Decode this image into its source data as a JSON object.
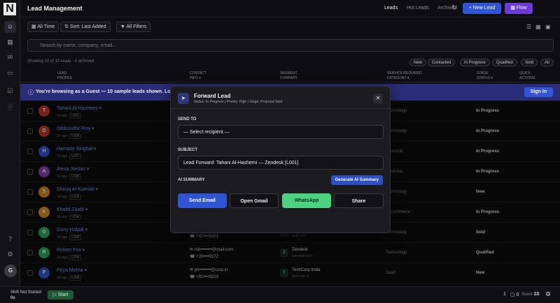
{
  "app": {
    "logo": "N",
    "title": "Lead Management",
    "tabs": [
      "Leads",
      "Hot Leads",
      "Archived"
    ],
    "new_lead": "+ New Lead",
    "flow": "Flow"
  },
  "sidebar": {
    "user_initial": "G"
  },
  "filters": {
    "all_time": "All Time",
    "sort": "Sort: Last Added",
    "all_filters": "All Filters"
  },
  "search": {
    "placeholder": "Search by name, company, email..."
  },
  "showing": "Showing 10 of 10 leads · 0 archived",
  "stat_chips": [
    "New",
    "Contacted",
    "In Progress",
    "Qualified",
    "Sold",
    "All"
  ],
  "columns": {
    "lead": [
      "LEAD",
      "PROFILE"
    ],
    "contact": [
      "CONTACT",
      "INFO ▾"
    ],
    "segment": [
      "SEGMENT",
      "COMPANY"
    ],
    "service": [
      "SERVICE REQUIRED",
      "CATEGORY ▾"
    ],
    "stage": [
      "STAGE",
      "STATUS ▾"
    ],
    "quick": [
      "QUICK",
      "ACTIONS"
    ]
  },
  "banner": {
    "text": "You're browsing as a Guest — 10 sample leads shown. Log in t",
    "signin": "Sign In"
  },
  "leads": [
    {
      "initial": "T",
      "color": "#c0392b",
      "name": "Tahani Al-Hashemi",
      "ago": "1d ago",
      "tag": "L001",
      "email": "",
      "phone": "",
      "company": "",
      "site": "",
      "category": "Technology",
      "status": "In Progress"
    },
    {
      "initial": "D",
      "color": "#c0392b",
      "name": "Dibbondho Roy",
      "ago": "2h ago",
      "tag": "L002",
      "email": "",
      "phone": "",
      "company": "",
      "site": "",
      "category": "Technology",
      "status": "In Progress"
    },
    {
      "initial": "H",
      "color": "#2f55d4",
      "name": "Hamasy Singhal",
      "ago": "2h ago",
      "tag": "L007",
      "email": "",
      "phone": "",
      "company": "",
      "site": "",
      "category": "Financial",
      "status": "In Progress"
    },
    {
      "initial": "A",
      "color": "#8e44ad",
      "name": "Alexa Jordan",
      "ago": "1d ago",
      "tag": "L005",
      "email": "",
      "phone": "",
      "company": "",
      "site": "",
      "category": "Financial",
      "status": "In Progress"
    },
    {
      "initial": "S",
      "color": "#d98b1f",
      "name": "Shouq Al-Kumaiti",
      "ago": "1d ago",
      "tag": "L003",
      "email": "",
      "phone": "",
      "company": "",
      "site": "",
      "category": "Technology",
      "status": "New"
    },
    {
      "initial": "K",
      "color": "#d98b1f",
      "name": "Khalid Zaabi",
      "ago": "2d ago",
      "tag": "L004",
      "email": "",
      "phone": "",
      "company": "",
      "site": "",
      "category": "E-Commerce",
      "status": "In Progress"
    },
    {
      "initial": "G",
      "color": "#27ae60",
      "name": "Gany Halpal",
      "ago": "2d ago",
      "tag": "L009",
      "email": "gan••••@mail.com",
      "phone": "+97••••8261",
      "company": "Audi",
      "site": "audi.com",
      "category": "Technology",
      "status": "Sold"
    },
    {
      "initial": "R",
      "color": "#27ae60",
      "name": "Robert Fox",
      "ago": "3d ago",
      "tag": "L006",
      "email": "rob••••••••@mail.com",
      "phone": "+20••••9272",
      "company": "Zendesk",
      "site": "zendesk.com",
      "category": "Technology",
      "status": "Qualified"
    },
    {
      "initial": "P",
      "color": "#2f55d4",
      "name": "Priya Mehta",
      "ago": "4d ago",
      "tag": "L008",
      "email": "pri••••••••@corp.in",
      "phone": "+91••••3210",
      "company": "TechCorp India",
      "site": "techcorp.in",
      "category": "SaaS",
      "status": "New"
    }
  ],
  "bottom": {
    "shift_line1": "Shift Not Started",
    "shift_line2": "0s",
    "start": "Start",
    "count1": "1",
    "count2": "0",
    "score_label": "Score",
    "score": "10"
  },
  "modal": {
    "title": "Forward Lead",
    "subtitle": "Status: In Progress | Priority: High | Stage: Proposal Sent",
    "send_to_label": "Send To",
    "send_to_value": "— Select recipient —",
    "subject_label": "Subject",
    "subject_value": "Lead Forward: Tahani Al-Hashemi — Zendesk [L001]",
    "ai_label": "AI Summary",
    "ai_button": "Generate AI Summary",
    "send_email": "Send Email",
    "open_gmail": "Open Gmail",
    "whatsapp": "WhatsApp",
    "share": "Share"
  },
  "colors": {
    "primary": "#2f55d4",
    "flow": "#6c3bd6",
    "banner": "#2a2d7a",
    "whatsapp": "#4cd381",
    "link": "#7a9cff"
  }
}
